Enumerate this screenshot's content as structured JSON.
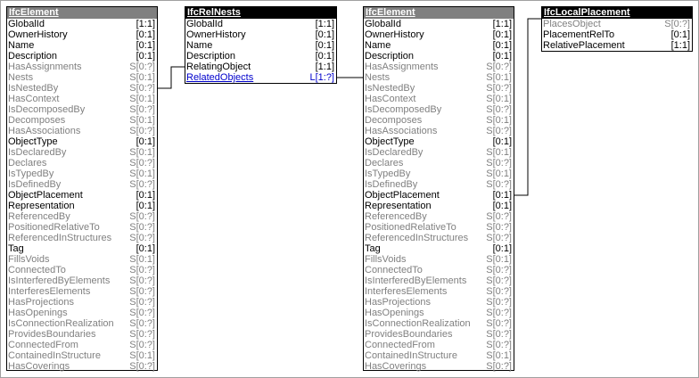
{
  "entities": {
    "elem1": {
      "title": "IfcElement",
      "attrs": [
        {
          "name": "GlobalId",
          "card": "[1:1]",
          "kind": "req"
        },
        {
          "name": "OwnerHistory",
          "card": "[0:1]",
          "kind": "req"
        },
        {
          "name": "Name",
          "card": "[0:1]",
          "kind": "req"
        },
        {
          "name": "Description",
          "card": "[0:1]",
          "kind": "req"
        },
        {
          "name": "HasAssignments",
          "card": "S[0:?]",
          "kind": "inv"
        },
        {
          "name": "Nests",
          "card": "S[0:1]",
          "kind": "inv"
        },
        {
          "name": "IsNestedBy",
          "card": "S[0:?]",
          "kind": "inv"
        },
        {
          "name": "HasContext",
          "card": "S[0:1]",
          "kind": "inv"
        },
        {
          "name": "IsDecomposedBy",
          "card": "S[0:?]",
          "kind": "inv"
        },
        {
          "name": "Decomposes",
          "card": "S[0:1]",
          "kind": "inv"
        },
        {
          "name": "HasAssociations",
          "card": "S[0:?]",
          "kind": "inv"
        },
        {
          "name": "ObjectType",
          "card": "[0:1]",
          "kind": "req"
        },
        {
          "name": "IsDeclaredBy",
          "card": "S[0:1]",
          "kind": "inv"
        },
        {
          "name": "Declares",
          "card": "S[0:?]",
          "kind": "inv"
        },
        {
          "name": "IsTypedBy",
          "card": "S[0:1]",
          "kind": "inv"
        },
        {
          "name": "IsDefinedBy",
          "card": "S[0:?]",
          "kind": "inv"
        },
        {
          "name": "ObjectPlacement",
          "card": "[0:1]",
          "kind": "req"
        },
        {
          "name": "Representation",
          "card": "[0:1]",
          "kind": "req"
        },
        {
          "name": "ReferencedBy",
          "card": "S[0:?]",
          "kind": "inv"
        },
        {
          "name": "PositionedRelativeTo",
          "card": "S[0:?]",
          "kind": "inv"
        },
        {
          "name": "ReferencedInStructures",
          "card": "S[0:?]",
          "kind": "inv"
        },
        {
          "name": "Tag",
          "card": "[0:1]",
          "kind": "req"
        },
        {
          "name": "FillsVoids",
          "card": "S[0:1]",
          "kind": "inv"
        },
        {
          "name": "ConnectedTo",
          "card": "S[0:?]",
          "kind": "inv"
        },
        {
          "name": "IsInterferedByElements",
          "card": "S[0:?]",
          "kind": "inv"
        },
        {
          "name": "InterferesElements",
          "card": "S[0:?]",
          "kind": "inv"
        },
        {
          "name": "HasProjections",
          "card": "S[0:?]",
          "kind": "inv"
        },
        {
          "name": "HasOpenings",
          "card": "S[0:?]",
          "kind": "inv"
        },
        {
          "name": "IsConnectionRealization",
          "card": "S[0:?]",
          "kind": "inv"
        },
        {
          "name": "ProvidesBoundaries",
          "card": "S[0:?]",
          "kind": "inv"
        },
        {
          "name": "ConnectedFrom",
          "card": "S[0:?]",
          "kind": "inv"
        },
        {
          "name": "ContainedInStructure",
          "card": "S[0:1]",
          "kind": "inv"
        },
        {
          "name": "HasCoverings",
          "card": "S[0:?]",
          "kind": "inv"
        }
      ]
    },
    "relnests": {
      "title": "IfcRelNests",
      "attrs": [
        {
          "name": "GlobalId",
          "card": "[1:1]",
          "kind": "req"
        },
        {
          "name": "OwnerHistory",
          "card": "[0:1]",
          "kind": "req"
        },
        {
          "name": "Name",
          "card": "[0:1]",
          "kind": "req"
        },
        {
          "name": "Description",
          "card": "[0:1]",
          "kind": "req"
        },
        {
          "name": "RelatingObject",
          "card": "[1:1]",
          "kind": "req"
        },
        {
          "name": "RelatedObjects",
          "card": "L[1:?]",
          "kind": "link"
        }
      ]
    },
    "elem2": {
      "title": "IfcElement",
      "attrs": [
        {
          "name": "GlobalId",
          "card": "[1:1]",
          "kind": "req"
        },
        {
          "name": "OwnerHistory",
          "card": "[0:1]",
          "kind": "req"
        },
        {
          "name": "Name",
          "card": "[0:1]",
          "kind": "req"
        },
        {
          "name": "Description",
          "card": "[0:1]",
          "kind": "req"
        },
        {
          "name": "HasAssignments",
          "card": "S[0:?]",
          "kind": "inv"
        },
        {
          "name": "Nests",
          "card": "S[0:1]",
          "kind": "inv"
        },
        {
          "name": "IsNestedBy",
          "card": "S[0:?]",
          "kind": "inv"
        },
        {
          "name": "HasContext",
          "card": "S[0:1]",
          "kind": "inv"
        },
        {
          "name": "IsDecomposedBy",
          "card": "S[0:?]",
          "kind": "inv"
        },
        {
          "name": "Decomposes",
          "card": "S[0:1]",
          "kind": "inv"
        },
        {
          "name": "HasAssociations",
          "card": "S[0:?]",
          "kind": "inv"
        },
        {
          "name": "ObjectType",
          "card": "[0:1]",
          "kind": "req"
        },
        {
          "name": "IsDeclaredBy",
          "card": "S[0:1]",
          "kind": "inv"
        },
        {
          "name": "Declares",
          "card": "S[0:?]",
          "kind": "inv"
        },
        {
          "name": "IsTypedBy",
          "card": "S[0:1]",
          "kind": "inv"
        },
        {
          "name": "IsDefinedBy",
          "card": "S[0:?]",
          "kind": "inv"
        },
        {
          "name": "ObjectPlacement",
          "card": "[0:1]",
          "kind": "req"
        },
        {
          "name": "Representation",
          "card": "[0:1]",
          "kind": "req"
        },
        {
          "name": "ReferencedBy",
          "card": "S[0:?]",
          "kind": "inv"
        },
        {
          "name": "PositionedRelativeTo",
          "card": "S[0:?]",
          "kind": "inv"
        },
        {
          "name": "ReferencedInStructures",
          "card": "S[0:?]",
          "kind": "inv"
        },
        {
          "name": "Tag",
          "card": "[0:1]",
          "kind": "req"
        },
        {
          "name": "FillsVoids",
          "card": "S[0:1]",
          "kind": "inv"
        },
        {
          "name": "ConnectedTo",
          "card": "S[0:?]",
          "kind": "inv"
        },
        {
          "name": "IsInterferedByElements",
          "card": "S[0:?]",
          "kind": "inv"
        },
        {
          "name": "InterferesElements",
          "card": "S[0:?]",
          "kind": "inv"
        },
        {
          "name": "HasProjections",
          "card": "S[0:?]",
          "kind": "inv"
        },
        {
          "name": "HasOpenings",
          "card": "S[0:?]",
          "kind": "inv"
        },
        {
          "name": "IsConnectionRealization",
          "card": "S[0:?]",
          "kind": "inv"
        },
        {
          "name": "ProvidesBoundaries",
          "card": "S[0:?]",
          "kind": "inv"
        },
        {
          "name": "ConnectedFrom",
          "card": "S[0:?]",
          "kind": "inv"
        },
        {
          "name": "ContainedInStructure",
          "card": "S[0:1]",
          "kind": "inv"
        },
        {
          "name": "HasCoverings",
          "card": "S[0:?]",
          "kind": "inv"
        }
      ]
    },
    "placement": {
      "title": "IfcLocalPlacement",
      "attrs": [
        {
          "name": "PlacesObject",
          "card": "S[0:?]",
          "kind": "inv"
        },
        {
          "name": "PlacementRelTo",
          "card": "[0:1]",
          "kind": "req"
        },
        {
          "name": "RelativePlacement",
          "card": "[1:1]",
          "kind": "req"
        }
      ]
    }
  },
  "colors": {
    "header_fill": "#808080",
    "header_fill_selected": "#000000",
    "inverse_attr": "#808080",
    "explicit_attr": "#000000",
    "link_attr": "#0000cc"
  }
}
